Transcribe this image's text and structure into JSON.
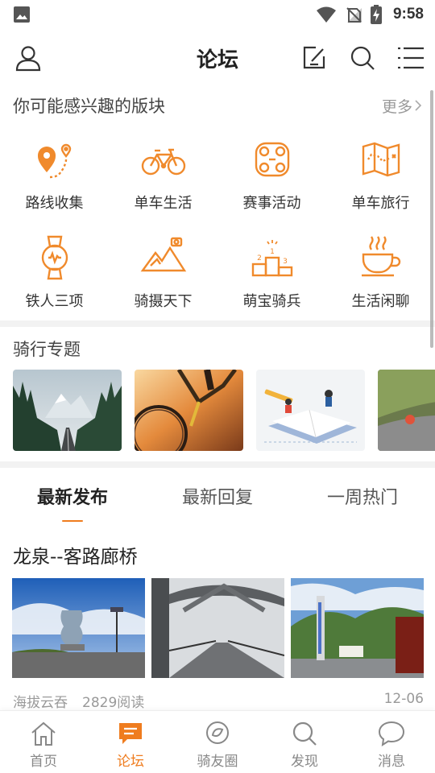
{
  "status_bar": {
    "time": "9:58"
  },
  "header": {
    "title": "论坛"
  },
  "interest_section": {
    "title": "你可能感兴趣的版块",
    "more_label": "更多",
    "items": [
      {
        "label": "路线收集",
        "icon": "route-pin-icon"
      },
      {
        "label": "单车生活",
        "icon": "bicycle-icon"
      },
      {
        "label": "赛事活动",
        "icon": "bike-chain-icon"
      },
      {
        "label": "单车旅行",
        "icon": "map-icon"
      },
      {
        "label": "铁人三项",
        "icon": "smartwatch-icon"
      },
      {
        "label": "骑摄天下",
        "icon": "mountain-camera-icon"
      },
      {
        "label": "萌宝骑兵",
        "icon": "podium-icon"
      },
      {
        "label": "生活闲聊",
        "icon": "coffee-cup-icon"
      }
    ]
  },
  "topics_section": {
    "title": "骑行专题"
  },
  "tabs": [
    {
      "label": "最新发布",
      "active": true
    },
    {
      "label": "最新回复",
      "active": false
    },
    {
      "label": "一周热门",
      "active": false
    }
  ],
  "post": {
    "title": "龙泉--客路廊桥",
    "author": "海拔云吞",
    "reads": "2829阅读",
    "date": "12-06"
  },
  "bottom_nav": [
    {
      "label": "首页",
      "icon": "home-icon",
      "active": false
    },
    {
      "label": "论坛",
      "icon": "forum-icon",
      "active": true
    },
    {
      "label": "骑友圈",
      "icon": "circle-chat-icon",
      "active": false
    },
    {
      "label": "发现",
      "icon": "discover-search-icon",
      "active": false
    },
    {
      "label": "消息",
      "icon": "message-bubble-icon",
      "active": false
    }
  ],
  "colors": {
    "accent": "#ef7c1e",
    "icon_orange": "#f08a2c",
    "text": "#222222",
    "muted": "#999999"
  }
}
